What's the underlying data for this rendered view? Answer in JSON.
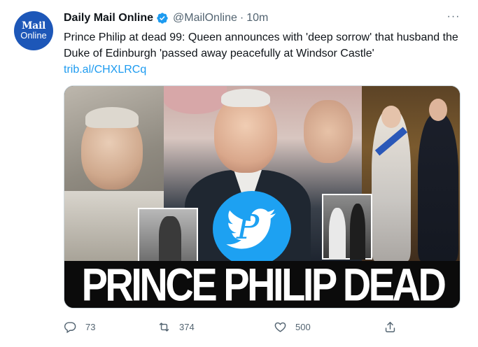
{
  "account": {
    "display_name": "Daily Mail Online",
    "handle": "@MailOnline",
    "separator": "·",
    "time": "10m",
    "avatar_line1": "Mail",
    "avatar_line2": "Online",
    "verified": true
  },
  "tweet": {
    "text": "Prince Philip at dead 99: Queen announces with 'deep sorrow' that husband the Duke of Edinburgh 'passed away peacefully at Windsor Castle'",
    "link": "trib.al/CHXLRCq",
    "more_menu": "···"
  },
  "media": {
    "headline": "PRINCE PHILIP DEAD",
    "badge_letter": "P"
  },
  "actions": {
    "reply_count": "73",
    "retweet_count": "374",
    "like_count": "500"
  },
  "colors": {
    "accent": "#1d9bf0",
    "text": "#0f1419",
    "secondary": "#536471",
    "avatar_bg": "#1d57b8",
    "twitter_blue": "#1da1f2"
  },
  "icons": {
    "verified": "verified-badge-icon",
    "reply": "reply-icon",
    "retweet": "retweet-icon",
    "like": "heart-icon",
    "share": "share-icon",
    "more": "more-dots-icon"
  }
}
